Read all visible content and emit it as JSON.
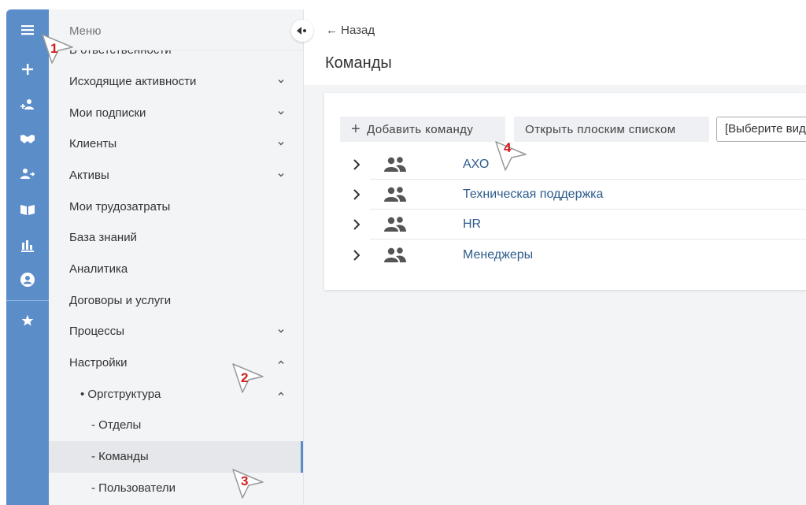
{
  "rail": {
    "icons": [
      "menu-icon",
      "plus-icon",
      "user-add-icon",
      "handshake-icon",
      "user-transfer-icon",
      "book-icon",
      "bar-chart-icon",
      "account-circle-icon",
      "star-icon"
    ],
    "color": "#5b8dc9"
  },
  "sidebar": {
    "title": "Меню",
    "cutoff_item": "В ответственности",
    "items": [
      {
        "label": "Исходящие активности",
        "chevron": "down"
      },
      {
        "label": "Мои подписки",
        "chevron": "down"
      },
      {
        "label": "Клиенты",
        "chevron": "down"
      },
      {
        "label": "Активы",
        "chevron": "down"
      },
      {
        "label": "Мои трудозатраты",
        "chevron": ""
      },
      {
        "label": "База знаний",
        "chevron": ""
      },
      {
        "label": "Аналитика",
        "chevron": ""
      },
      {
        "label": "Договоры и услуги",
        "chevron": ""
      },
      {
        "label": "Процессы",
        "chevron": "down"
      },
      {
        "label": "Настройки",
        "chevron": "up"
      },
      {
        "label": "• Оргструктура",
        "chevron": "up"
      },
      {
        "label": "- Отделы",
        "chevron": ""
      },
      {
        "label": "- Команды",
        "chevron": "",
        "active": true
      },
      {
        "label": "- Пользователи",
        "chevron": ""
      }
    ]
  },
  "main": {
    "back_label": "← Назад",
    "title": "Команды",
    "add_button_label": "Добавить команду",
    "flat_list_button_label": "Открыть плоским списком",
    "select_placeholder": "[Выберите вид",
    "teams": [
      "АХО",
      "Техническая поддержка",
      "HR",
      "Менеджеры"
    ]
  },
  "annotations": [
    "1",
    "2",
    "3",
    "4"
  ],
  "colors": {
    "accent": "#5b8dc9",
    "link": "#2d5b8c",
    "marker": "#d31a1a"
  }
}
